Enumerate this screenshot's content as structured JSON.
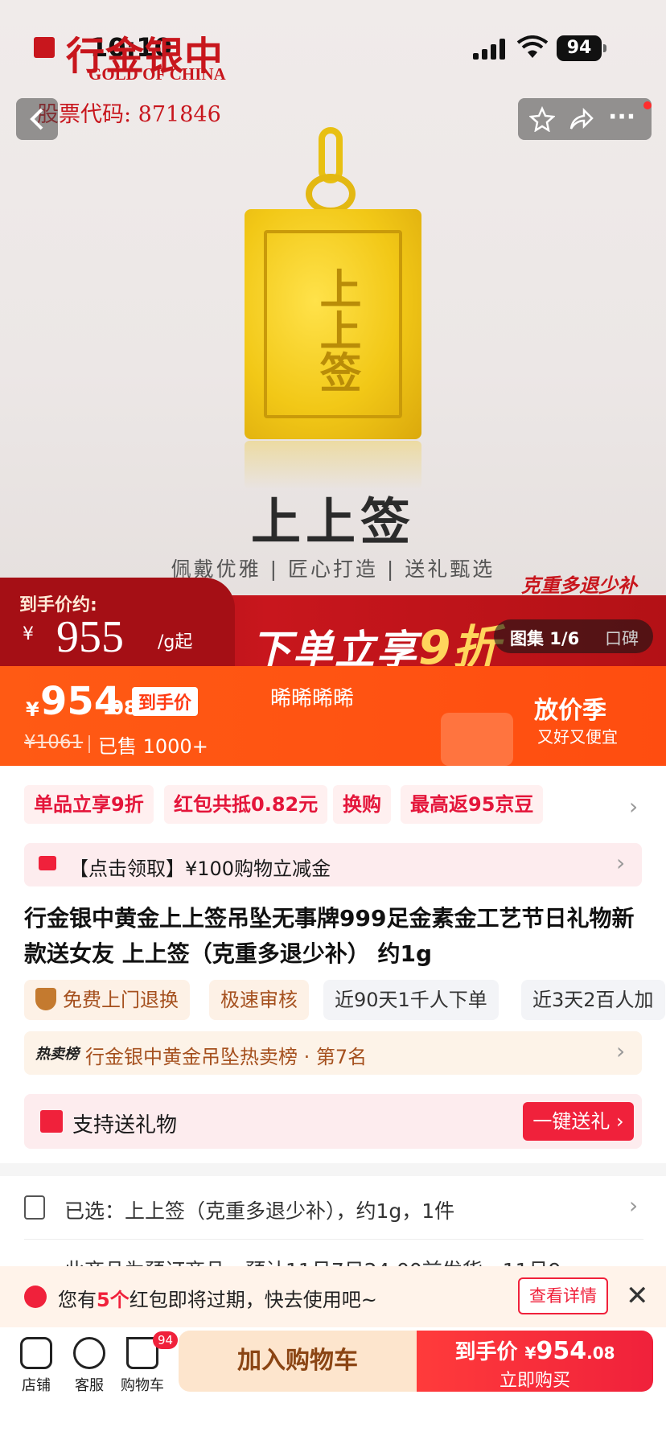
{
  "status_bar": {
    "time": "10:10",
    "battery": "94"
  },
  "hero": {
    "brand_cn": "行金银中",
    "brand_en": "GOLD OF CHINA",
    "stock_code": "股票代码: 871846",
    "pendant_chars": "上上签",
    "product_name": "上上签",
    "subtitle": "佩戴优雅 | 匠心打造 | 送礼甄选",
    "badge": "克重多退少补",
    "price_label": "到手价约:",
    "price_currency": "¥",
    "price_value": "955",
    "price_unit": "/g起",
    "promo": "下单立享",
    "promo_highlight": "9折",
    "gallery": "图集 1/6",
    "reviews": "口碑"
  },
  "price_banner": {
    "currency": "¥",
    "price_int": "954",
    "price_dec": ".08",
    "price_tag": "到手价",
    "original_price": "¥1061",
    "sold": "已售 1000+",
    "middle_text": "晞晞晞晞",
    "season": "放价季",
    "slogan": "又好又便宜"
  },
  "promo_chips": [
    "单品立享9折",
    "红包共抵0.82元",
    "换购",
    "最高返95京豆"
  ],
  "coupon": {
    "text": "【点击领取】¥100购物立减金"
  },
  "product_title": "行金银中黄金上上签吊坠无事牌999足金素金工艺节日礼物新款送女友 上上签（克重多退少补） 约1g",
  "service_tags": [
    "免费上门退换",
    "极速审核",
    "近90天1千人下单",
    "近3天2百人加"
  ],
  "ranking": {
    "logo": "热卖榜",
    "text": "行金银中黄金吊坠热卖榜 · 第7名"
  },
  "gift": {
    "text": "支持送礼物",
    "button": "一键送礼"
  },
  "spec": {
    "text": "已选：上上签（克重多退少补），约1g，1件"
  },
  "shipping": {
    "text": "此商品为预订商品，预计11月7日24:00前发货，11月9..."
  },
  "toast": {
    "prefix": "您有",
    "count": "5个",
    "suffix": "红包即将过期，快去使用吧~",
    "button": "查看详情",
    "close": "✕"
  },
  "bottom_bar": {
    "nav": [
      {
        "label": "店铺",
        "icon": "store-icon"
      },
      {
        "label": "客服",
        "icon": "chat-icon"
      },
      {
        "label": "购物车",
        "icon": "cart-icon"
      }
    ],
    "cart_badge": "94",
    "add_to_cart": "加入购物车",
    "buy_label": "到手价",
    "buy_currency": "¥",
    "buy_price_int": "954",
    "buy_price_dec": ".08",
    "buy_now": "立即购买"
  },
  "colors": {
    "accent_red": "#f0213b",
    "banner_orange": "#ff5a14",
    "brand_red": "#c8161d",
    "gold": "#f2c817"
  }
}
